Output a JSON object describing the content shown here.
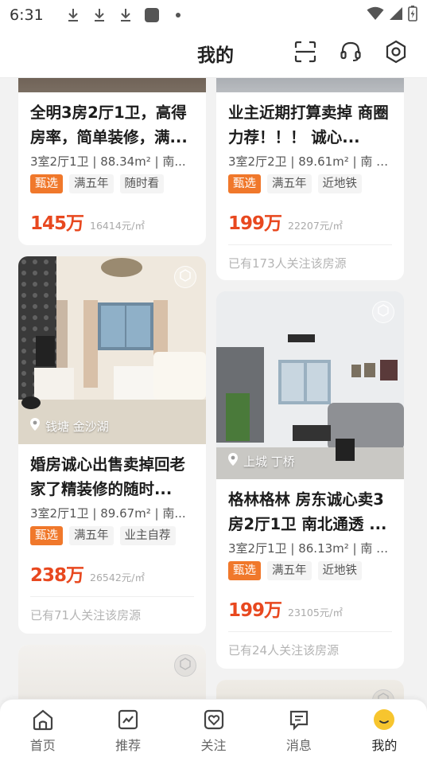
{
  "status_bar": {
    "time": "6:31"
  },
  "header": {
    "title": "我的"
  },
  "cards": [
    {
      "title": "全明3房2厅1卫，高得房率，简单装修，满...",
      "meta": "3室2厅1卫 | 88.34m² | 南...",
      "tags": [
        "甄选",
        "满五年",
        "随时看"
      ],
      "price": "145万",
      "unit_price": "16414元/㎡"
    },
    {
      "title": "业主近期打算卖掉 商圈力荐！！！ 诚心...",
      "meta": "3室2厅2卫 | 89.61m² | 南 | ...",
      "tags": [
        "甄选",
        "满五年",
        "近地铁"
      ],
      "price": "199万",
      "unit_price": "22207元/㎡",
      "follow": "已有173人关注该房源"
    },
    {
      "location": "钱塘 金沙湖",
      "title": "婚房诚心出售卖掉回老家了精装修的随时...",
      "meta": "3室2厅1卫 | 89.67m² | 南...",
      "tags": [
        "甄选",
        "满五年",
        "业主自荐"
      ],
      "price": "238万",
      "unit_price": "26542元/㎡",
      "follow": "已有71人关注该房源"
    },
    {
      "location": "上城 丁桥",
      "title": "格林格林 房东诚心卖3房2厅1卫 南北通透 ...",
      "meta": "3室2厅1卫 | 86.13m² | 南 | ...",
      "tags": [
        "甄选",
        "满五年",
        "近地铁"
      ],
      "price": "199万",
      "unit_price": "23105元/㎡",
      "follow": "已有24人关注该房源"
    }
  ],
  "bottom_nav": [
    {
      "label": "首页",
      "icon": "home-icon"
    },
    {
      "label": "推荐",
      "icon": "trend-icon"
    },
    {
      "label": "关注",
      "icon": "heart-icon"
    },
    {
      "label": "消息",
      "icon": "message-icon"
    },
    {
      "label": "我的",
      "icon": "avatar-icon",
      "active": true
    }
  ],
  "colors": {
    "accent": "#e8481f",
    "tag_highlight": "#f0782b",
    "nav_active": "#f7c52e"
  }
}
